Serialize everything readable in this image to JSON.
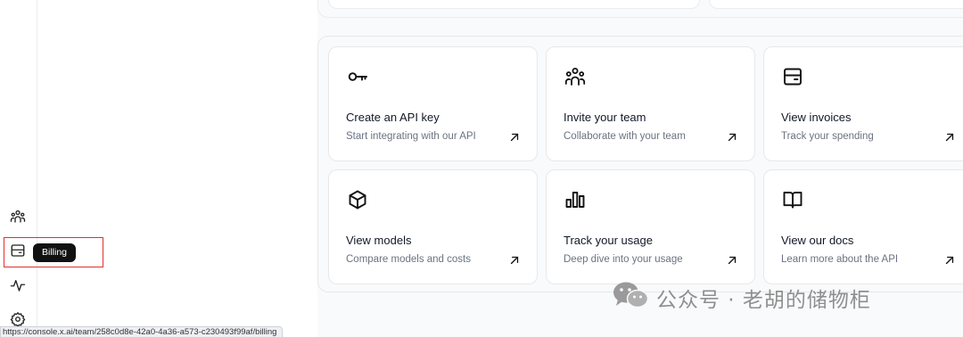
{
  "sidebar": {
    "items": [
      {
        "icon": "team-icon"
      },
      {
        "icon": "billing-icon"
      },
      {
        "icon": "activity-icon"
      },
      {
        "icon": "settings-icon"
      }
    ],
    "tooltip": "Billing"
  },
  "cards": [
    {
      "icon": "key-icon",
      "title": "Create an API key",
      "subtitle": "Start integrating with our API"
    },
    {
      "icon": "team-icon",
      "title": "Invite your team",
      "subtitle": "Collaborate with your team"
    },
    {
      "icon": "invoice-icon",
      "title": "View invoices",
      "subtitle": "Track your spending"
    },
    {
      "icon": "cube-icon",
      "title": "View models",
      "subtitle": "Compare models and costs"
    },
    {
      "icon": "bar-chart-icon",
      "title": "Track your usage",
      "subtitle": "Deep dive into your usage"
    },
    {
      "icon": "book-icon",
      "title": "View our docs",
      "subtitle": "Learn more about the API"
    }
  ],
  "status_url": "https://console.x.ai/team/258c0d8e-42a0-4a36-a573-c230493f99af/billing",
  "watermark": "公众号 · 老胡的储物柜",
  "colors": {
    "highlight": "#e0312f",
    "tooltip_bg": "#111111",
    "panel_bg": "#f9fafb"
  }
}
